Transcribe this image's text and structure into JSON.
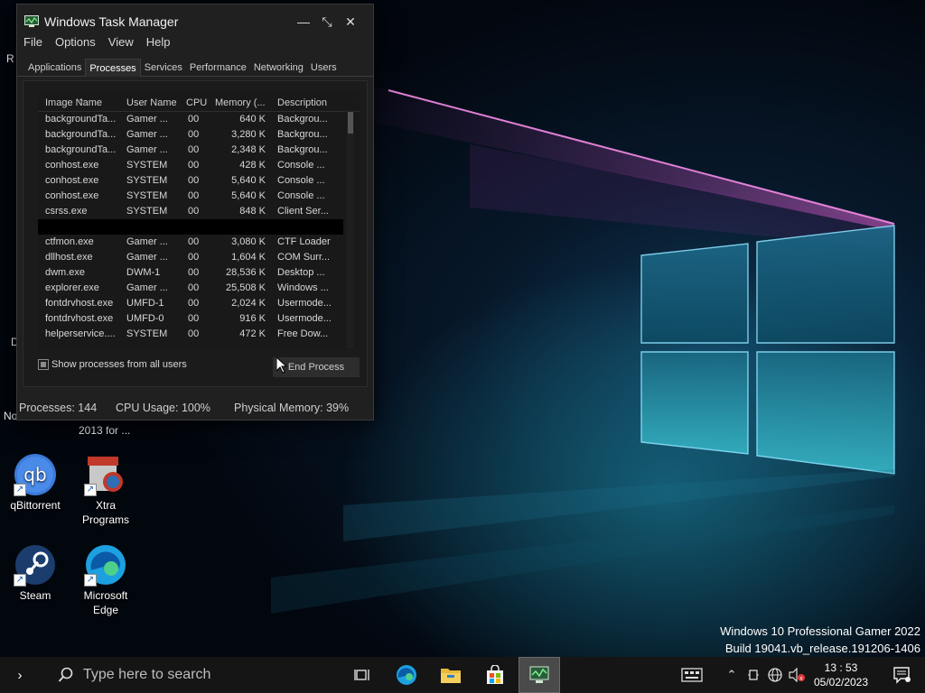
{
  "taskmgr": {
    "title": "Windows Task Manager",
    "menu": [
      "File",
      "Options",
      "View",
      "Help"
    ],
    "tabs": [
      "Applications",
      "Processes",
      "Services",
      "Performance",
      "Networking",
      "Users"
    ],
    "active_tab": "Processes",
    "columns": [
      "Image Name",
      "User Name",
      "CPU",
      "Memory (...",
      "Description"
    ],
    "rows_top": [
      {
        "name": "backgroundTa...",
        "user": "Gamer ...",
        "cpu": "00",
        "mem": "640 K",
        "desc": "Backgrou..."
      },
      {
        "name": "backgroundTa...",
        "user": "Gamer ...",
        "cpu": "00",
        "mem": "3,280 K",
        "desc": "Backgrou..."
      },
      {
        "name": "backgroundTa...",
        "user": "Gamer ...",
        "cpu": "00",
        "mem": "2,348 K",
        "desc": "Backgrou..."
      },
      {
        "name": "conhost.exe",
        "user": "SYSTEM",
        "cpu": "00",
        "mem": "428 K",
        "desc": "Console ..."
      },
      {
        "name": "conhost.exe",
        "user": "SYSTEM",
        "cpu": "00",
        "mem": "5,640 K",
        "desc": "Console ..."
      },
      {
        "name": "conhost.exe",
        "user": "SYSTEM",
        "cpu": "00",
        "mem": "5,640 K",
        "desc": "Console ..."
      },
      {
        "name": "csrss.exe",
        "user": "SYSTEM",
        "cpu": "00",
        "mem": "848 K",
        "desc": "Client Ser..."
      }
    ],
    "rows_bottom": [
      {
        "name": "ctfmon.exe",
        "user": "Gamer ...",
        "cpu": "00",
        "mem": "3,080 K",
        "desc": "CTF Loader"
      },
      {
        "name": "dllhost.exe",
        "user": "Gamer ...",
        "cpu": "00",
        "mem": "1,604 K",
        "desc": "COM Surr..."
      },
      {
        "name": "dwm.exe",
        "user": "DWM-1",
        "cpu": "00",
        "mem": "28,536 K",
        "desc": "Desktop ..."
      },
      {
        "name": "explorer.exe",
        "user": "Gamer ...",
        "cpu": "00",
        "mem": "25,508 K",
        "desc": "Windows ..."
      },
      {
        "name": "fontdrvhost.exe",
        "user": "UMFD-1",
        "cpu": "00",
        "mem": "2,024 K",
        "desc": "Usermode..."
      },
      {
        "name": "fontdrvhost.exe",
        "user": "UMFD-0",
        "cpu": "00",
        "mem": "916 K",
        "desc": "Usermode..."
      },
      {
        "name": "helperservice....",
        "user": "SYSTEM",
        "cpu": "00",
        "mem": "472 K",
        "desc": "Free Dow..."
      }
    ],
    "show_all_label": "Show processes from all users",
    "end_process_label": "End Process",
    "status": {
      "processes": "Processes: 144",
      "cpu": "CPU Usage: 100%",
      "memory": "Physical Memory: 39%"
    }
  },
  "desktop": {
    "icons": [
      {
        "label": "qBittorrent",
        "icon": "qbittorrent-icon"
      },
      {
        "label": "Xtra Programs",
        "icon": "xtra-programs-icon"
      },
      {
        "label": "Steam",
        "icon": "steam-icon"
      },
      {
        "label": "Microsoft Edge",
        "icon": "edge-icon"
      }
    ],
    "partial_labels": {
      "left_r": "R",
      "left_d": "D",
      "no_fragment": "No",
      "year_fragment": "2013 for ..."
    }
  },
  "watermark": {
    "line1": "Windows 10 Professional Gamer 2022",
    "line2": "Build 19041.vb_release.191206-1406"
  },
  "taskbar": {
    "search_placeholder": "Type here to search",
    "time": "13 : 53",
    "date": "05/02/2023",
    "apps": [
      "task-view-icon",
      "edge-icon",
      "file-explorer-icon",
      "store-icon",
      "task-manager-icon"
    ]
  },
  "colors": {
    "window_bg": "#202020",
    "taskbar_bg": "#151515",
    "wallpaper_glow": "#2fb8d6",
    "beam_pink": "#d04fc0"
  }
}
